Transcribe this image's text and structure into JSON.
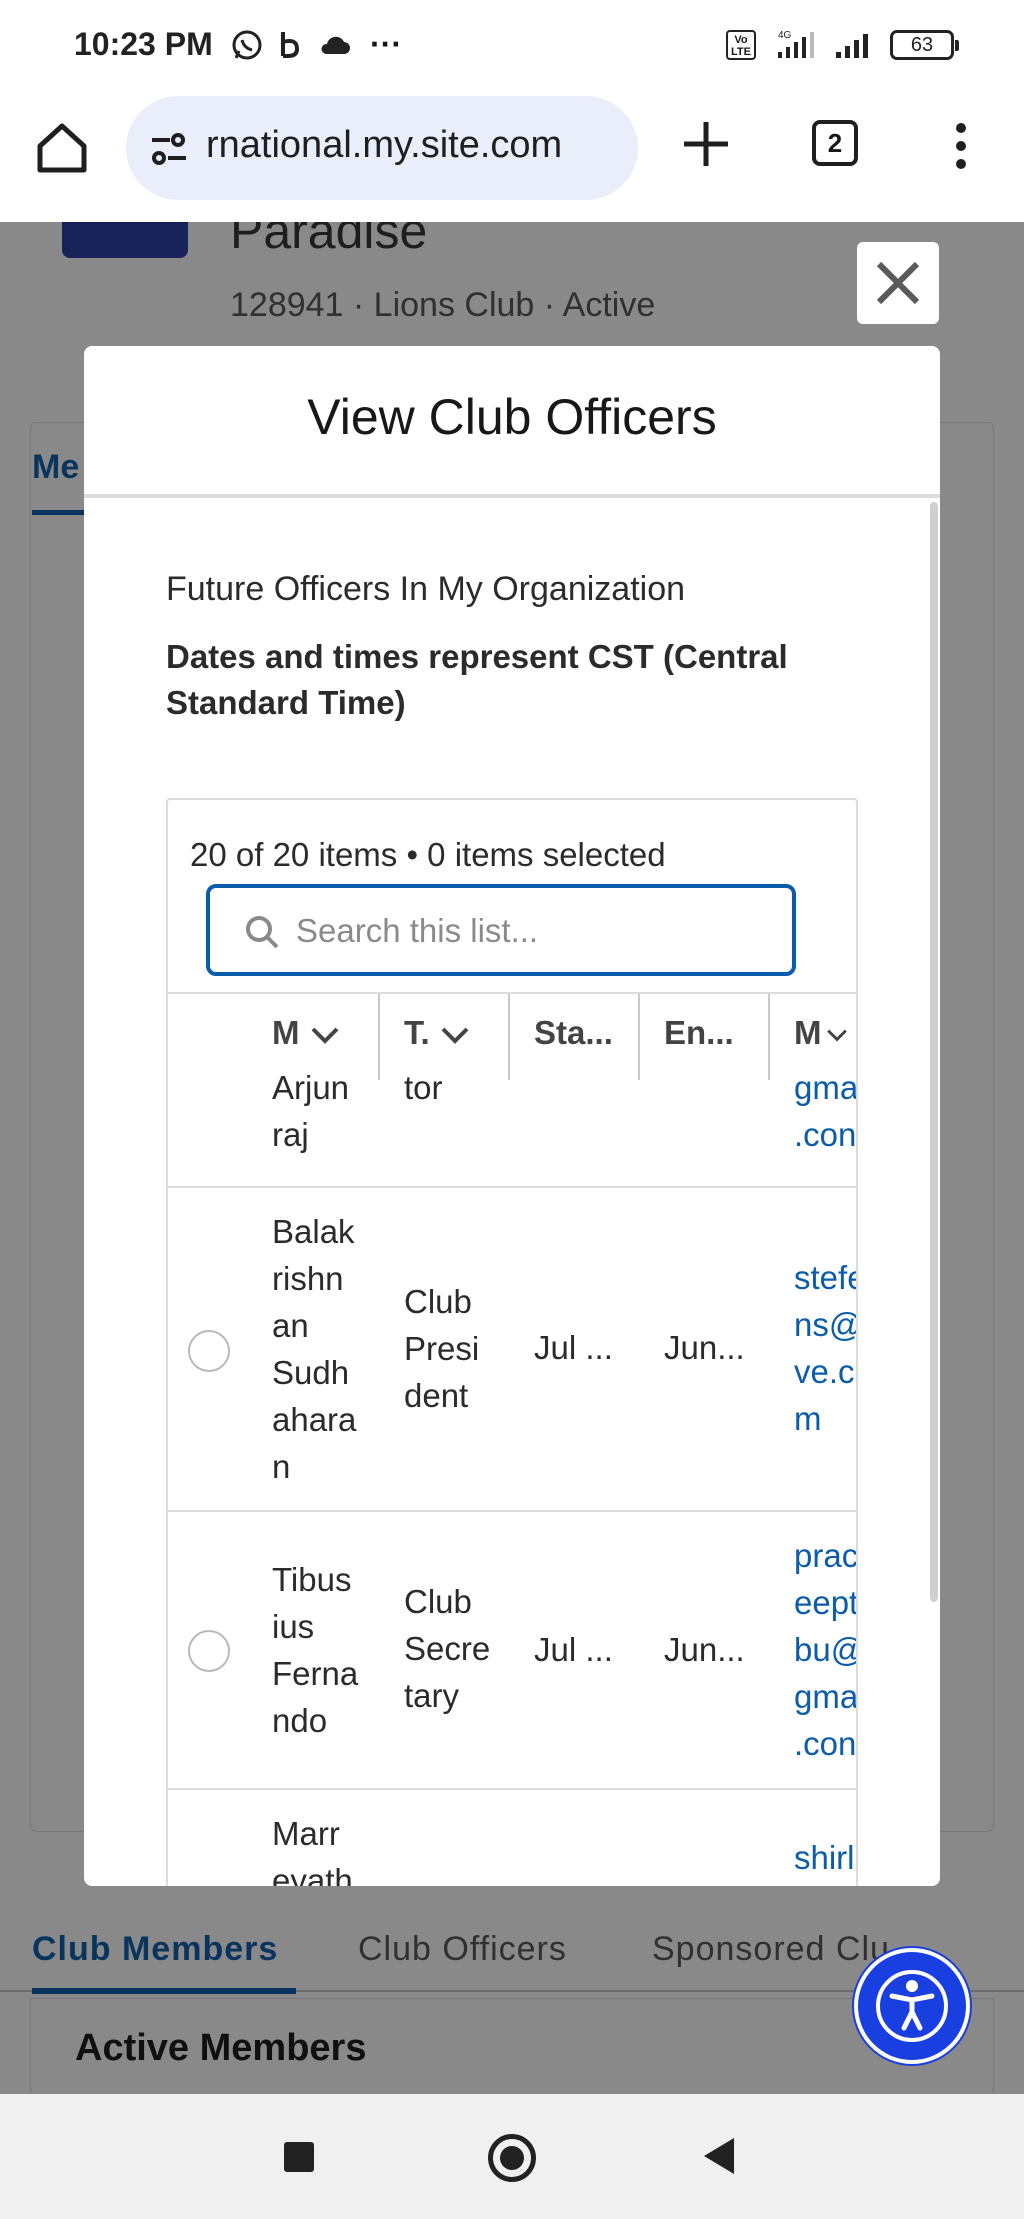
{
  "status_bar": {
    "time": "10:23 PM",
    "more": "···",
    "volte_label": "Vo LTE",
    "network_label": "4G",
    "battery": "63"
  },
  "browser": {
    "url": "rnational.my.site.com",
    "tab_count": "2"
  },
  "page": {
    "club_name": "Paradise",
    "club_meta": "128941 · Lions Club · Active",
    "card_tab_label": "Me",
    "tabs": [
      {
        "label": "Club Members",
        "active": true
      },
      {
        "label": "Club Officers",
        "active": false
      },
      {
        "label": "Sponsored Clu...",
        "active": false
      }
    ],
    "active_members_title": "Active Members"
  },
  "modal": {
    "title": "View Club Officers",
    "section_heading": "Future Officers In My Organization",
    "timezone_note": "Dates and times represent CST (Central Standard Time)",
    "items_count": "20 of 20 items • 0 items selected",
    "search_placeholder": "Search this list...",
    "columns": [
      {
        "label": "M",
        "has_menu": true
      },
      {
        "label": "T.",
        "has_menu": true
      },
      {
        "label": "Sta...",
        "has_menu": false
      },
      {
        "label": "En...",
        "has_menu": false
      },
      {
        "label": "M",
        "has_menu": true
      }
    ],
    "rows": [
      {
        "name": "Arjun\nraj",
        "title": "tor",
        "start": "",
        "end": "",
        "email": "gma\n.con",
        "has_radio": false
      },
      {
        "name": "Balak\nrishn\nan\nSudh\nahara\nn",
        "title": "Club\nPresi\ndent",
        "start": "Jul ...",
        "end": "Jun...",
        "email": "stefe\nns@\nve.c\nm",
        "has_radio": true
      },
      {
        "name": "Tibus\nius\nFerna\nndo",
        "title": "Club\nSecre\ntary",
        "start": "Jul ...",
        "end": "Jun...",
        "email": "prac\neept\nbu@\ngma\n.con",
        "has_radio": true
      },
      {
        "name": "Marr\neyath",
        "title": "",
        "start": "",
        "end": "",
        "email": "shirl",
        "has_radio": false
      }
    ]
  },
  "colors": {
    "accent": "#0b5cab",
    "fab": "#1a3fe0",
    "club_logo": "#2a3aa3"
  }
}
